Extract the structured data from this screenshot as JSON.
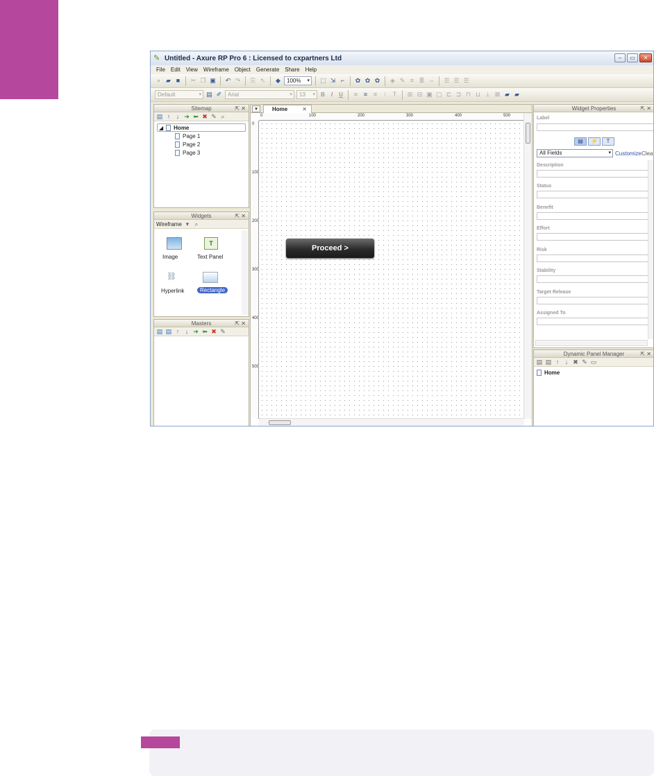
{
  "window": {
    "title": "Untitled - Axure RP Pro 6 : Licensed to cxpartners Ltd",
    "minimize": "–",
    "restore": "▭",
    "close": "✕"
  },
  "menu": [
    "File",
    "Edit",
    "View",
    "Wireframe",
    "Object",
    "Generate",
    "Share",
    "Help"
  ],
  "toolbar": {
    "zoom": "100%",
    "style_combo": "Default",
    "font_combo": "Arial",
    "font_size": "13",
    "bold": "B",
    "italic": "I",
    "underline": "U"
  },
  "sitemap": {
    "title": "Sitemap",
    "controls": "⇱ ✕",
    "items": [
      "Home",
      "Page 1",
      "Page 2",
      "Page 3"
    ]
  },
  "widgets": {
    "title": "Widgets",
    "controls": "⇱ ✕",
    "library": "Wireframe",
    "items": [
      "Image",
      "Text Panel",
      "Hyperlink",
      "Rectangle"
    ]
  },
  "masters": {
    "title": "Masters",
    "controls": "⇱ ✕"
  },
  "canvas": {
    "tab": "Home",
    "tab_close": "✕",
    "ruler_top": [
      "0",
      "100",
      "200",
      "300",
      "400",
      "500"
    ],
    "ruler_left": [
      "0",
      "100",
      "200",
      "300",
      "400",
      "500"
    ],
    "button_label": "Proceed >"
  },
  "properties": {
    "title": "Widget Properties",
    "controls": "⇱ ✕",
    "label_heading": "Label",
    "filter": "All Fields",
    "customize": "Customize",
    "clear": "Clear",
    "fields": [
      "Description",
      "Status",
      "Benefit",
      "Effort",
      "Risk",
      "Stability",
      "Target Release",
      "Assigned To"
    ]
  },
  "dynamic_panel": {
    "title": "Dynamic Panel Manager",
    "controls": "⇱ ✕",
    "item": "Home"
  },
  "colors": {
    "accent": "#b5489c",
    "note_bg": "#f2f1f5"
  }
}
